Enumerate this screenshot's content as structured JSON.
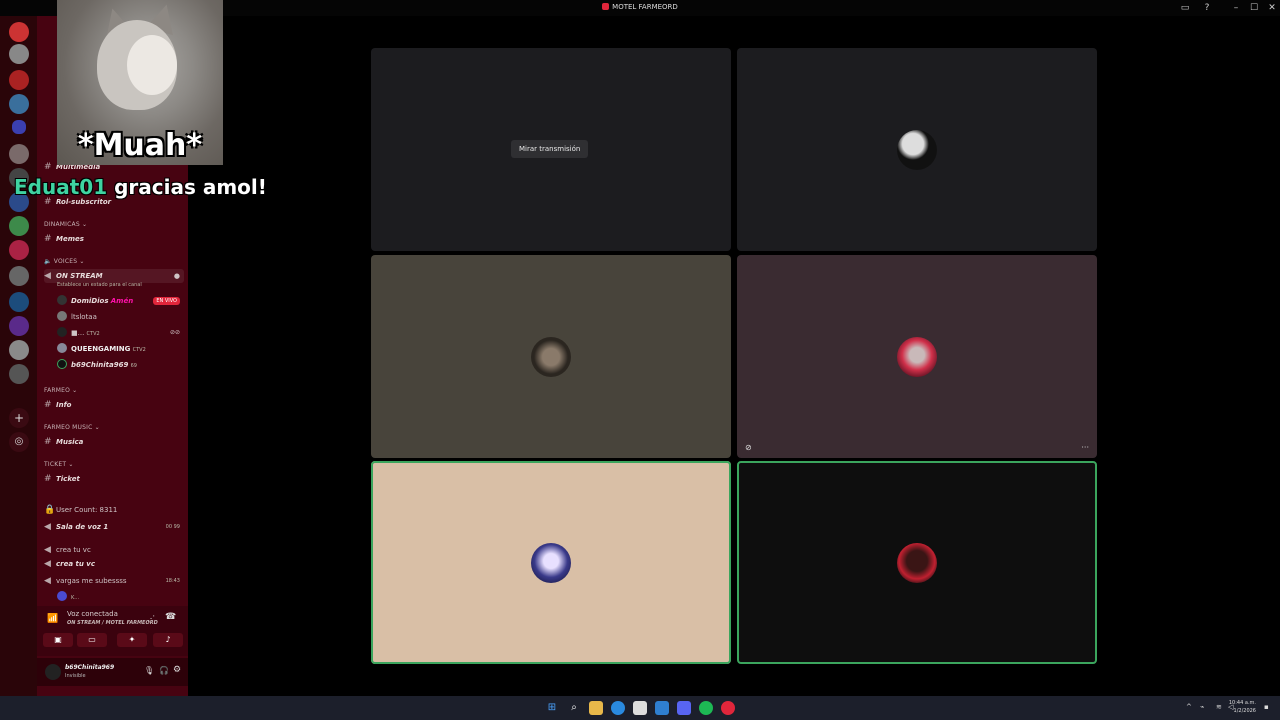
{
  "window": {
    "title": "MOTEL FARMEORD",
    "minimize": "–",
    "maximize": "☐",
    "close": "✕"
  },
  "overlay": {
    "caption": "*Muah*",
    "nick": "Eduat01",
    "message": " gracias amol!"
  },
  "sidebar": {
    "channels_top": [
      {
        "label": "Multimedia"
      },
      {
        "label": "Rol-subscritor"
      }
    ],
    "dinamicas_header": "DINAMICAS",
    "memes": "Memes",
    "voices_header": "VOICES",
    "on_stream": "ON STREAM",
    "status_hint": "Establece un estado para el canal",
    "voice_users": [
      {
        "name": "DomiDios",
        "tag": "Amén",
        "live": "EN VIVO"
      },
      {
        "name": "ltslotaa"
      },
      {
        "name": "■...",
        "tag": "CTV2"
      },
      {
        "name": "QUEENGAMING",
        "tag": "CTV2"
      },
      {
        "name": "b69Chinita969",
        "tag": "69"
      }
    ],
    "farmeo_header": "FARMEO",
    "info": "Info",
    "farmeo_music_header": "FARMEO MUSIC",
    "musica": "Musica",
    "ticket_header": "TICKET",
    "ticket": "Ticket",
    "user_count": "User Count: 8311",
    "sala_voz": "Sala de voz 1",
    "sala_counts": "00 99",
    "crea_header": "crea tu vc",
    "crea_channel": "crea tu vc",
    "vargas": "vargas me subessss",
    "vargas_time": "18:43",
    "vargas_user": "K..."
  },
  "voice_panel": {
    "title": "Voz conectada",
    "subtitle": "ON STREAM / MOTEL FARMEORD"
  },
  "user_panel": {
    "name": "b69Chinita969",
    "status": "Invisible"
  },
  "stage": {
    "watch_label": "Mirar transmisión"
  },
  "taskbar": {
    "time": "10:44 a.m.",
    "date": "1/2/2026"
  },
  "colors": {
    "sidebar": "#470311",
    "rail": "#2a0509",
    "speaking_ring": "#3ba55d",
    "live_badge": "#e0263b"
  }
}
